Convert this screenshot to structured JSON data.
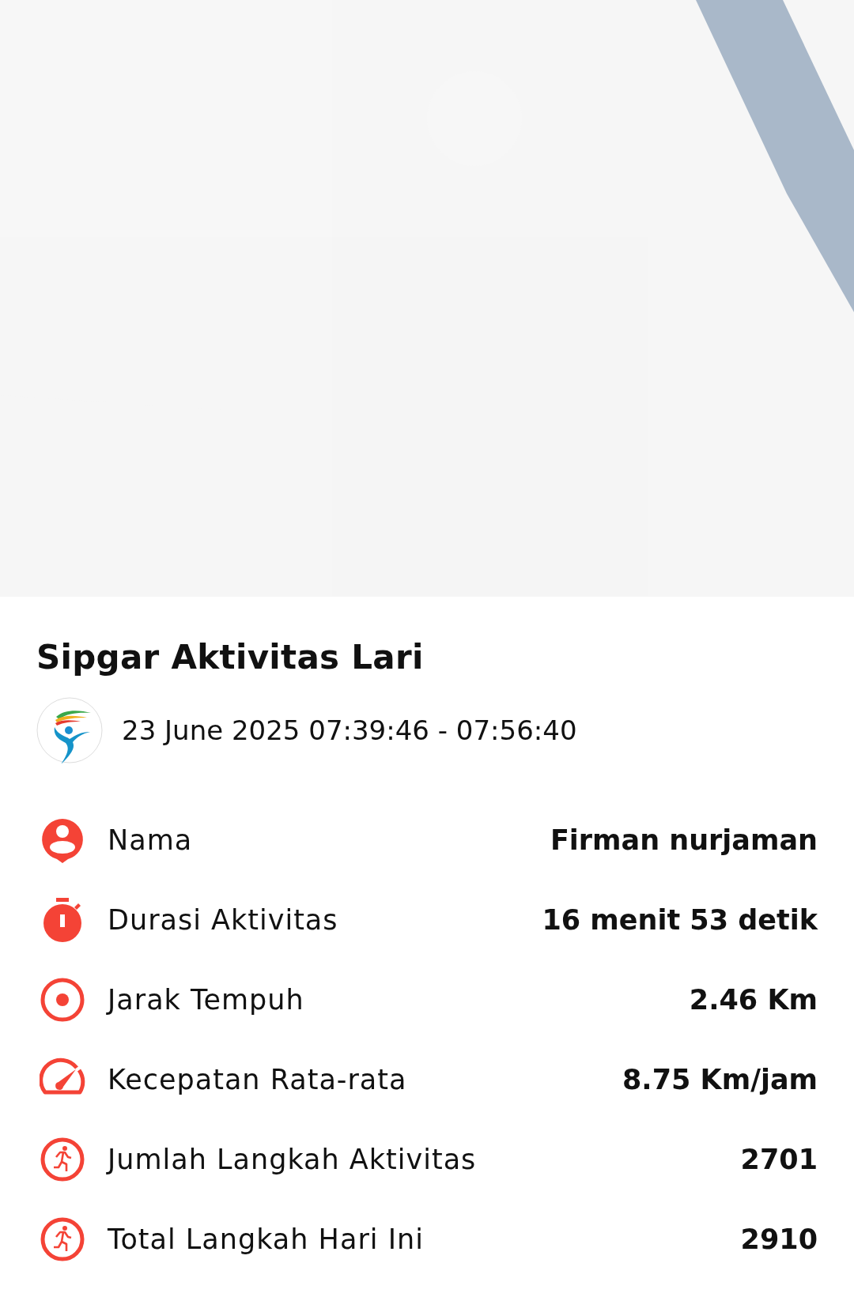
{
  "activity": {
    "title": "Sipgar Aktivitas Lari",
    "datetime": "23 June 2025 07:39:46 - 07:56:40"
  },
  "stats": [
    {
      "kind": "person",
      "label": "Nama",
      "value": "Firman nurjaman"
    },
    {
      "kind": "timer",
      "label": "Durasi Aktivitas",
      "value": "16 menit 53 detik"
    },
    {
      "kind": "target",
      "label": "Jarak Tempuh",
      "value": "2.46 Km"
    },
    {
      "kind": "speed",
      "label": "Kecepatan Rata-rata",
      "value": "8.75 Km/jam"
    },
    {
      "kind": "steps",
      "label": "Jumlah Langkah Aktivitas",
      "value": "2701"
    },
    {
      "kind": "steps",
      "label": "Total Langkah Hari Ini",
      "value": "2910"
    }
  ]
}
